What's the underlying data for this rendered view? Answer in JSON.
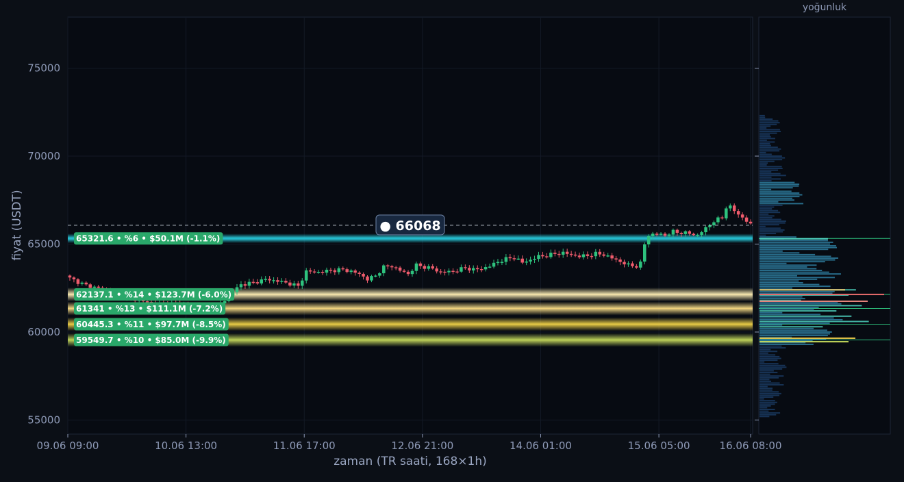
{
  "chart_data": [
    {
      "type": "candlestick",
      "xlabel": "zaman (TR saati, 168×1h)",
      "ylabel": "fiyat (USDT)",
      "ylim": [
        54200,
        77900
      ],
      "yticks": [
        55000,
        60000,
        65000,
        70000,
        75000
      ],
      "xticks": [
        "09.06 09:00",
        "10.06 13:00",
        "11.06 17:00",
        "12.06 21:00",
        "14.06 01:00",
        "15.06 05:00",
        "16.06 08:00"
      ],
      "candle_count": 168,
      "current_price": 66068,
      "current_price_label": "● 66068",
      "grid": true,
      "close_path": [
        [
          0,
          63150
        ],
        [
          2,
          62950
        ],
        [
          5,
          62650
        ],
        [
          8,
          62500
        ],
        [
          12,
          62250
        ],
        [
          16,
          61900
        ],
        [
          20,
          61700
        ],
        [
          24,
          61550
        ],
        [
          28,
          61600
        ],
        [
          32,
          61300
        ],
        [
          35,
          61200
        ],
        [
          37,
          61400
        ],
        [
          39,
          61800
        ],
        [
          41,
          62300
        ],
        [
          43,
          62700
        ],
        [
          46,
          62800
        ],
        [
          49,
          63000
        ],
        [
          52,
          62900
        ],
        [
          55,
          62750
        ],
        [
          57,
          62600
        ],
        [
          59,
          63450
        ],
        [
          62,
          63400
        ],
        [
          65,
          63500
        ],
        [
          68,
          63550
        ],
        [
          70,
          63450
        ],
        [
          72,
          63300
        ],
        [
          74,
          63000
        ],
        [
          76,
          63200
        ],
        [
          78,
          63700
        ],
        [
          80,
          63750
        ],
        [
          82,
          63500
        ],
        [
          84,
          63300
        ],
        [
          86,
          63800
        ],
        [
          88,
          63700
        ],
        [
          90,
          63600
        ],
        [
          92,
          63400
        ],
        [
          95,
          63450
        ],
        [
          98,
          63650
        ],
        [
          100,
          63550
        ],
        [
          102,
          63600
        ],
        [
          104,
          63750
        ],
        [
          106,
          64000
        ],
        [
          108,
          64150
        ],
        [
          110,
          64250
        ],
        [
          112,
          63950
        ],
        [
          114,
          64100
        ],
        [
          116,
          64300
        ],
        [
          118,
          64350
        ],
        [
          120,
          64450
        ],
        [
          122,
          64500
        ],
        [
          124,
          64400
        ],
        [
          126,
          64300
        ],
        [
          128,
          64350
        ],
        [
          130,
          64450
        ],
        [
          132,
          64400
        ],
        [
          134,
          64200
        ],
        [
          136,
          64000
        ],
        [
          138,
          63800
        ],
        [
          140,
          63750
        ],
        [
          141,
          63900
        ],
        [
          142,
          65000
        ],
        [
          143,
          65500
        ],
        [
          145,
          65600
        ],
        [
          147,
          65500
        ],
        [
          149,
          65700
        ],
        [
          151,
          65650
        ],
        [
          153,
          65600
        ],
        [
          155,
          65500
        ],
        [
          157,
          65900
        ],
        [
          159,
          66300
        ],
        [
          161,
          66500
        ],
        [
          162,
          67100
        ],
        [
          163,
          67100
        ],
        [
          164,
          66900
        ],
        [
          165,
          66700
        ],
        [
          166,
          66500
        ],
        [
          167,
          66300
        ],
        [
          168,
          66100
        ]
      ]
    },
    {
      "type": "levels",
      "levels": [
        {
          "price": 65321.6,
          "label": "65321.6 • %6 • $50.1M (-1.1%)",
          "color": "#1fb7c8"
        },
        {
          "price": 62137.1,
          "label": "62137.1 • %14 • $123.7M (-6.0%)",
          "color": "#f7e6a8"
        },
        {
          "price": 61341,
          "label": "61341 • %13 • $111.1M (-7.2%)",
          "color": "#f0d27a"
        },
        {
          "price": 60445.3,
          "label": "60445.3 • %11 • $97.7M (-8.5%)",
          "color": "#e6c64a"
        },
        {
          "price": 59549.7,
          "label": "59549.7 • %10 • $85.0M (-9.9%)",
          "color": "#b7cc58"
        }
      ]
    },
    {
      "type": "bar",
      "orientation": "horizontal",
      "title": "yoğunluk",
      "note": "volume profile by price"
    }
  ],
  "colors": {
    "background": "#0b0f16",
    "plot_bg": "#070b12",
    "up": "#2ec27e",
    "down": "#ee5b6c",
    "label_bg": "#2aa86a",
    "price_box": "#18283f",
    "profile_dark": "#1a3b63",
    "profile_mid": "#2e7ea0",
    "profile_hi": "#4fd3c0"
  }
}
